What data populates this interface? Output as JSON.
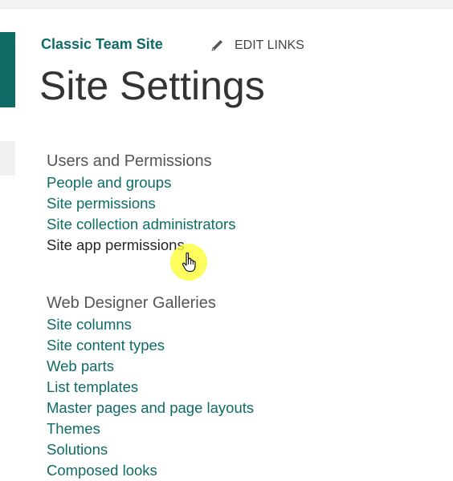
{
  "header": {
    "site_title": "Classic Team Site",
    "edit_links": "EDIT LINKS",
    "page_title": "Site Settings"
  },
  "sections": [
    {
      "heading": "Users and Permissions",
      "links": [
        "People and groups",
        "Site permissions",
        "Site collection administrators",
        "Site app permissions"
      ]
    },
    {
      "heading": "Web Designer Galleries",
      "links": [
        "Site columns",
        "Site content types",
        "Web parts",
        "List templates",
        "Master pages and page layouts",
        "Themes",
        "Solutions",
        "Composed looks"
      ]
    }
  ],
  "colors": {
    "accent": "#0e6b65",
    "cursor_highlight": "#fcfc34"
  }
}
